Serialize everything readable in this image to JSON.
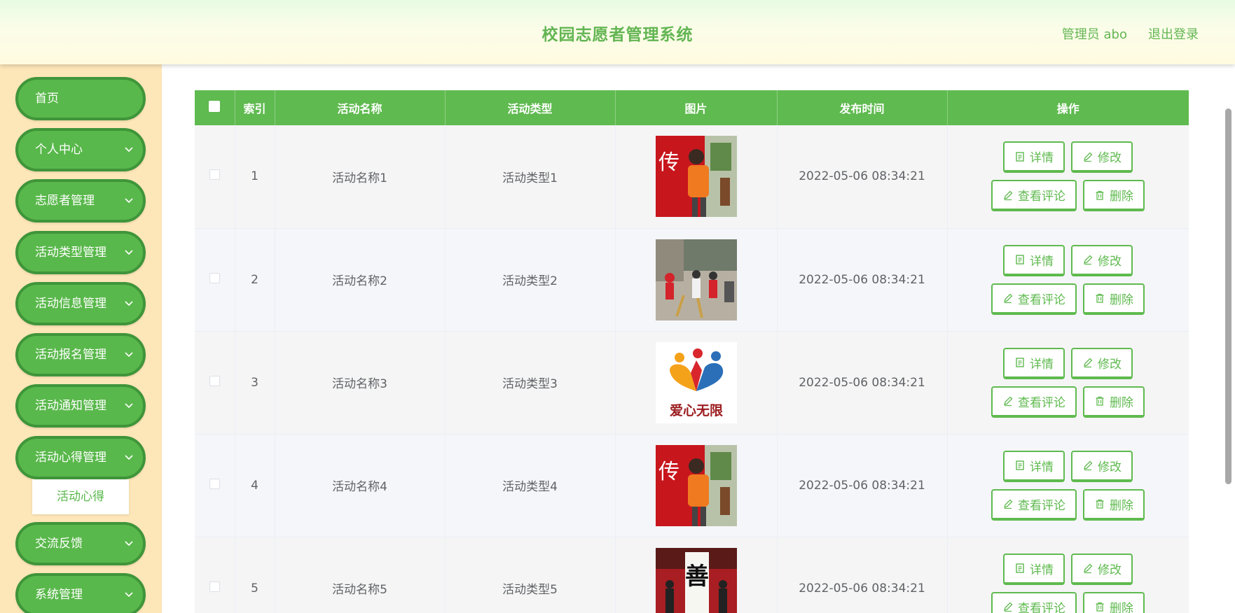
{
  "header": {
    "title": "校园志愿者管理系统",
    "user": "管理员 abo",
    "logout": "退出登录"
  },
  "sidebar": {
    "items": [
      {
        "label": "首页"
      },
      {
        "label": "个人中心"
      },
      {
        "label": "志愿者管理"
      },
      {
        "label": "活动类型管理"
      },
      {
        "label": "活动信息管理"
      },
      {
        "label": "活动报名管理"
      },
      {
        "label": "活动通知管理"
      },
      {
        "label": "活动心得管理"
      },
      {
        "label": "交流反馈"
      },
      {
        "label": "系统管理"
      }
    ],
    "submenu_label": "活动心得"
  },
  "table": {
    "headers": [
      "索引",
      "活动名称",
      "活动类型",
      "图片",
      "发布时间",
      "操作"
    ],
    "rows": [
      {
        "index": "1",
        "name": "活动名称1",
        "type": "活动类型1",
        "image": "volunteer-photo-banner",
        "time": "2022-05-06 08:34:21"
      },
      {
        "index": "2",
        "name": "活动名称2",
        "type": "活动类型2",
        "image": "volunteer-photo-sweeping",
        "time": "2022-05-06 08:34:21"
      },
      {
        "index": "3",
        "name": "活动名称3",
        "type": "活动类型3",
        "image": "love-logo",
        "time": "2022-05-06 08:34:21"
      },
      {
        "index": "4",
        "name": "活动名称4",
        "type": "活动类型4",
        "image": "volunteer-photo-banner",
        "time": "2022-05-06 08:34:21"
      },
      {
        "index": "5",
        "name": "活动名称5",
        "type": "活动类型5",
        "image": "volunteer-photo-calligraphy",
        "time": "2022-05-06 08:34:21"
      }
    ],
    "actions": {
      "detail": "详情",
      "edit": "修改",
      "comments": "查看评论",
      "delete": "删除"
    }
  },
  "colors": {
    "primary": "#5fba4f",
    "sidebar_bg": "#fde6b8",
    "header_title": "#63b553"
  },
  "love_logo_text": "爱心无限"
}
